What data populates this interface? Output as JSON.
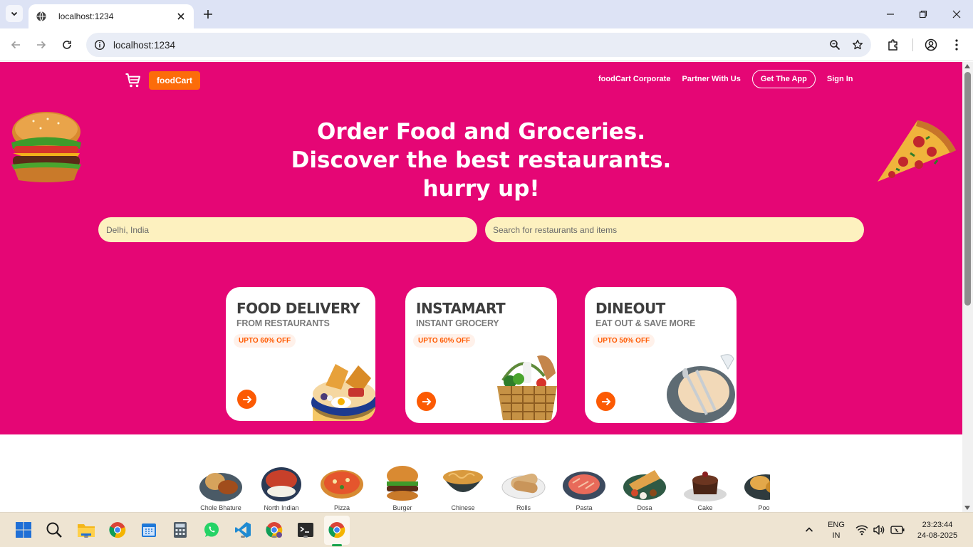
{
  "browser": {
    "tab_title": "localhost:1234",
    "url": "localhost:1234"
  },
  "header": {
    "logo_text": "foodCart",
    "nav": [
      "foodCart Corporate",
      "Partner With Us",
      "Get The App",
      "Sign In"
    ]
  },
  "hero": {
    "headline_lines": [
      "Order Food and Groceries.",
      "Discover the best restaurants.",
      "hurry up!"
    ],
    "location_placeholder": "Delhi, India",
    "search_placeholder": "Search for restaurants and items"
  },
  "cards": [
    {
      "title": "FOOD DELIVERY",
      "subtitle": "FROM RESTAURANTS",
      "offer": "UPTO 60% OFF"
    },
    {
      "title": "INSTAMART",
      "subtitle": "INSTANT GROCERY",
      "offer": "UPTO 60% OFF"
    },
    {
      "title": "DINEOUT",
      "subtitle": "EAT OUT & SAVE MORE",
      "offer": "UPTO 50% OFF"
    }
  ],
  "categories": [
    "Chole Bhature",
    "North Indian",
    "Pizza",
    "Burger",
    "Chinese",
    "Rolls",
    "Pasta",
    "Dosa",
    "Cake",
    "Poori"
  ],
  "taskbar": {
    "lang_line1": "ENG",
    "lang_line2": "IN",
    "time": "23:23:44",
    "date": "24-08-2025"
  },
  "colors": {
    "hero_bg": "#e50675",
    "accent_orange": "#fc6c0a",
    "search_bg": "#fdf1bf"
  }
}
